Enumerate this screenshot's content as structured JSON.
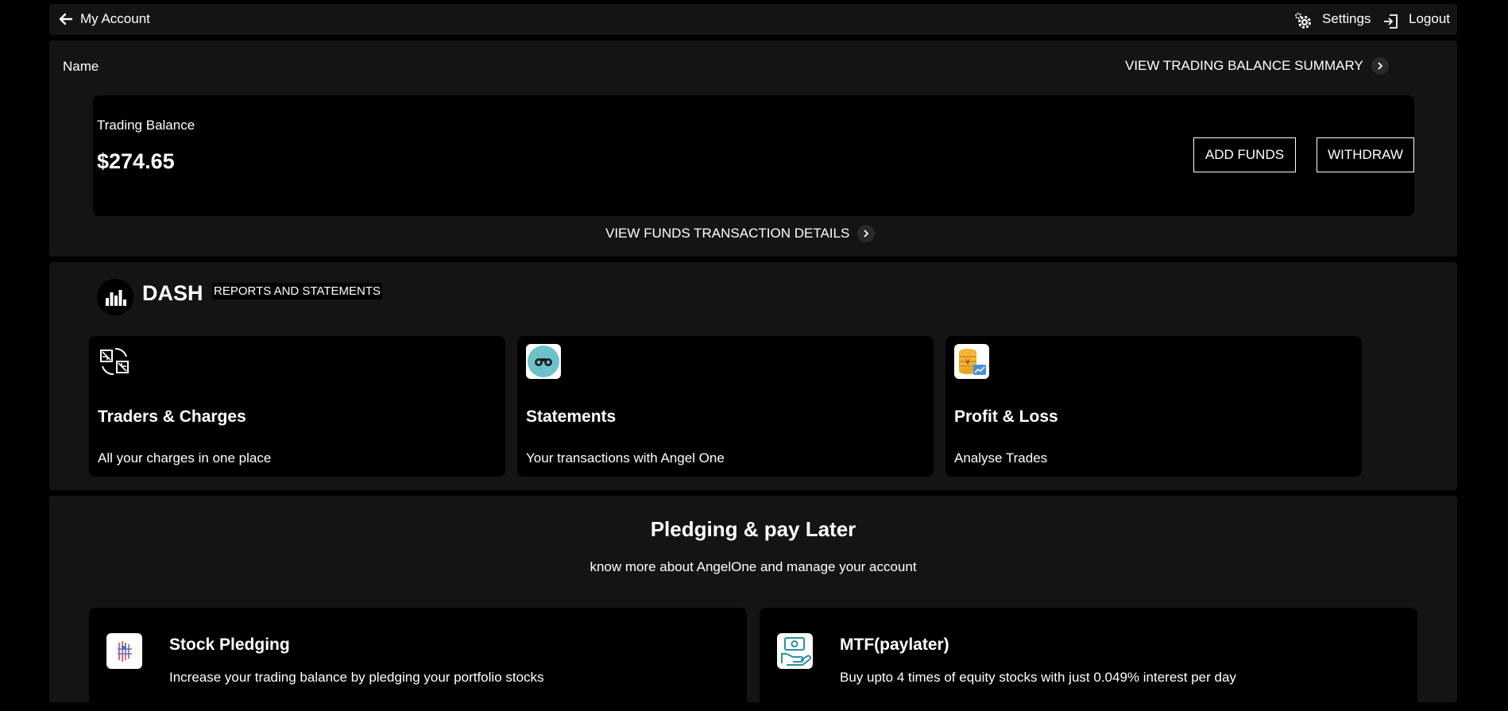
{
  "header": {
    "title": "My Account",
    "settings_label": "Settings",
    "logout_label": "Logout"
  },
  "account": {
    "name_label": "Name",
    "view_summary_label": "VIEW TRADING BALANCE SUMMARY",
    "balance_label": "Trading Balance",
    "balance_value": "$274.65",
    "add_funds_label": "ADD FUNDS",
    "withdraw_label": "WITHDRAW",
    "view_funds_label": "VIEW FUNDS TRANSACTION DETAILS"
  },
  "dash": {
    "title": "DASH",
    "subtitle": "REPORTS AND STATEMENTS",
    "cards": [
      {
        "title": "Traders & Charges",
        "desc": "All your charges in one place",
        "icon": "charges-icon"
      },
      {
        "title": "Statements",
        "desc": "Your transactions with Angel One",
        "icon": "binoculars-icon"
      },
      {
        "title": "Profit & Loss",
        "desc": "Analyse Trades",
        "icon": "coins-chart-icon"
      }
    ]
  },
  "pledge": {
    "title": "Pledging & pay Later",
    "subtitle": "know more about AngelOne and manage your account",
    "cards": [
      {
        "title": "Stock Pledging",
        "desc": "Increase your trading balance by pledging your portfolio stocks",
        "icon": "stock-pledging-icon"
      },
      {
        "title": "MTF(paylater)",
        "desc": "Buy upto 4 times of equity stocks with just 0.049% interest per day",
        "icon": "cash-hand-icon"
      }
    ]
  },
  "colors": {
    "background": "#000000",
    "panel": "#141414",
    "accent_teal": "#6cc2c8"
  }
}
